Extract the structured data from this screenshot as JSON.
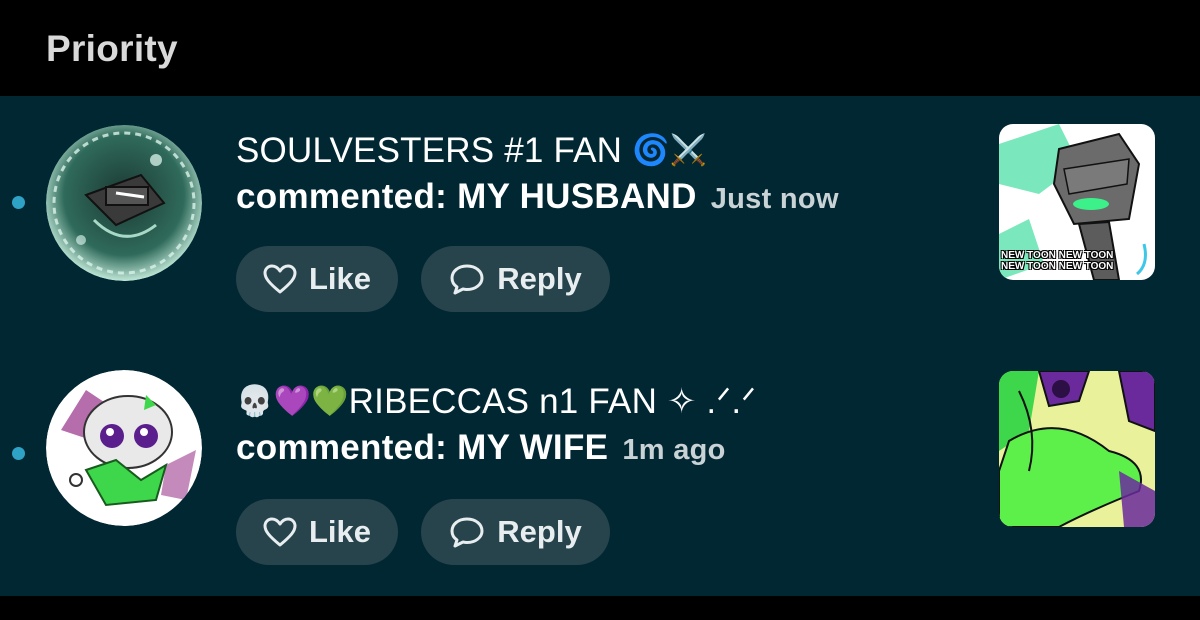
{
  "header": {
    "title": "Priority"
  },
  "notifications": [
    {
      "username": "SOULVESTERS #1 FAN",
      "username_prefix_emoji": "",
      "username_suffix_emoji": "🌀⚔️",
      "comment": "commented: MY HUSBAND",
      "timestamp": "Just now",
      "like_label": "Like",
      "reply_label": "Reply",
      "thumbnail_caption": "NEW TOON NEW TOON\nNEW TOON NEW TOON"
    },
    {
      "username": "RIBECCAS n1 FAN ✧ .ᐟ.ᐟ",
      "username_prefix_emoji": "💀💜💚",
      "username_suffix_emoji": "",
      "comment": "commented: MY WIFE",
      "timestamp": "1m ago",
      "like_label": "Like",
      "reply_label": "Reply",
      "thumbnail_caption": ""
    }
  ],
  "colors": {
    "background": "#000000",
    "list_background": "#012733",
    "button_background": "#27444d",
    "unread_dot": "#2fa3c6"
  },
  "icons": [
    "heart-icon",
    "speech-bubble-icon"
  ]
}
